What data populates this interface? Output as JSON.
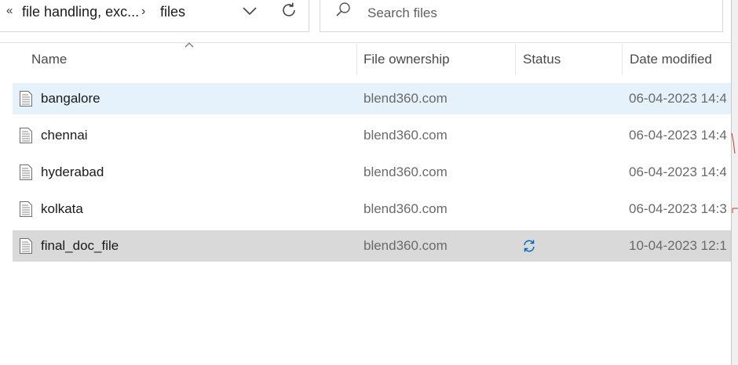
{
  "address_bar": {
    "more_glyph": "«",
    "path": [
      {
        "label": "file handling, exc..."
      },
      {
        "label": "files"
      }
    ],
    "separator_glyph": "›",
    "dropdown_icon": "chevron-down-icon",
    "refresh_icon": "refresh-icon"
  },
  "search": {
    "placeholder": "Search files",
    "value": "",
    "icon": "search-icon"
  },
  "columns": {
    "name": "Name",
    "ownership": "File ownership",
    "status": "Status",
    "date_modified": "Date modified",
    "sort_indicator": "sort-ascending-icon"
  },
  "files": [
    {
      "name": "bangalore",
      "owner": "blend360.com",
      "status": "",
      "date": "06-04-2023 14:4",
      "state": "hover"
    },
    {
      "name": "chennai",
      "owner": "blend360.com",
      "status": "",
      "date": "06-04-2023 14:4",
      "state": "normal"
    },
    {
      "name": "hyderabad",
      "owner": "blend360.com",
      "status": "",
      "date": "06-04-2023 14:4",
      "state": "normal"
    },
    {
      "name": "kolkata",
      "owner": "blend360.com",
      "status": "",
      "date": "06-04-2023 14:3",
      "state": "normal"
    },
    {
      "name": "final_doc_file",
      "owner": "blend360.com",
      "status": "sync-pending-icon",
      "date": "10-04-2023 12:1",
      "state": "selected"
    }
  ],
  "colors": {
    "hover_row": "#e5f1fb",
    "selected_row": "#d9d9d9",
    "sync_blue": "#0067c0"
  }
}
